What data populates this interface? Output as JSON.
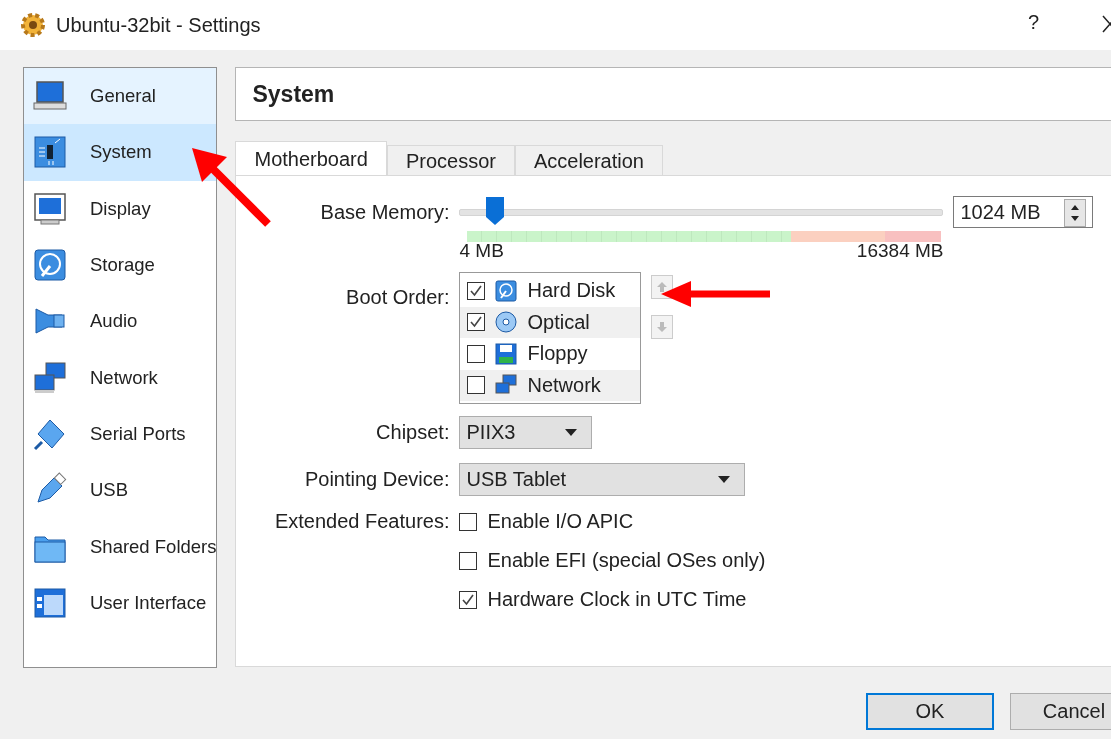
{
  "window": {
    "title": "Ubuntu-32bit - Settings",
    "help": "?"
  },
  "sidebar": {
    "items": [
      {
        "label": "General",
        "selected": false,
        "hovered": true
      },
      {
        "label": "System",
        "selected": true,
        "hovered": false
      },
      {
        "label": "Display",
        "selected": false,
        "hovered": false
      },
      {
        "label": "Storage",
        "selected": false,
        "hovered": false
      },
      {
        "label": "Audio",
        "selected": false,
        "hovered": false
      },
      {
        "label": "Network",
        "selected": false,
        "hovered": false
      },
      {
        "label": "Serial Ports",
        "selected": false,
        "hovered": false
      },
      {
        "label": "USB",
        "selected": false,
        "hovered": false
      },
      {
        "label": "Shared Folders",
        "selected": false,
        "hovered": false
      },
      {
        "label": "User Interface",
        "selected": false,
        "hovered": false
      }
    ]
  },
  "page_title": "System",
  "tabs": [
    {
      "label": "Motherboard",
      "selected": true
    },
    {
      "label": "Processor",
      "selected": false
    },
    {
      "label": "Acceleration",
      "selected": false
    }
  ],
  "base_memory": {
    "label": "Base Memory:",
    "level": 0.06,
    "min_label": "4 MB",
    "max_label": "16384 MB",
    "value": "1024 MB"
  },
  "boot_order": {
    "label": "Boot Order:",
    "items": [
      {
        "label": "Hard Disk",
        "checked": true
      },
      {
        "label": "Optical",
        "checked": true
      },
      {
        "label": "Floppy",
        "checked": false
      },
      {
        "label": "Network",
        "checked": false
      }
    ]
  },
  "chipset": {
    "label": "Chipset:",
    "value": "PIIX3"
  },
  "pointing_device": {
    "label": "Pointing Device:",
    "value": "USB Tablet"
  },
  "extended_features": {
    "label": "Extended Features:",
    "options": [
      {
        "label": "Enable I/O APIC",
        "checked": false
      },
      {
        "label": "Enable EFI (special OSes only)",
        "checked": false
      },
      {
        "label": "Hardware Clock in UTC Time",
        "checked": true
      }
    ]
  },
  "buttons": [
    {
      "label": "OK",
      "default": true
    },
    {
      "label": "Cancel",
      "default": false
    }
  ]
}
